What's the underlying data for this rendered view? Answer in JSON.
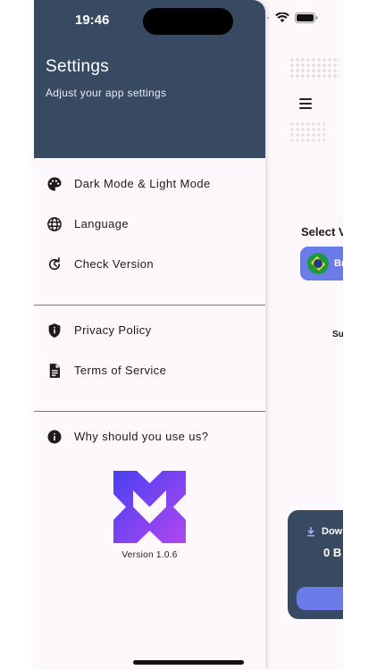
{
  "status_bar": {
    "time": "19:46"
  },
  "drawer": {
    "title": "Settings",
    "subtitle": "Adjust your app settings",
    "group1": [
      {
        "label": "Dark Mode & Light Mode",
        "icon": "palette-icon"
      },
      {
        "label": "Language",
        "icon": "globe-icon"
      },
      {
        "label": "Check Version",
        "icon": "refresh-icon"
      }
    ],
    "group2": [
      {
        "label": "Privacy Policy",
        "icon": "shield-icon"
      },
      {
        "label": "Terms of Service",
        "icon": "document-icon"
      }
    ],
    "group3": [
      {
        "label": "Why should you use us?",
        "icon": "info-icon"
      }
    ],
    "version": "Version 1.0.6"
  },
  "background_app": {
    "select_label": "Select V",
    "country_chip_text": "Br",
    "small_label": "Su",
    "download_label": "Dow",
    "download_value": "0 B"
  },
  "colors": {
    "header_bg": "#384a61",
    "drawer_bg": "#fcf8fc",
    "accent": "#6a7ce8",
    "card_bg": "#374a61"
  }
}
